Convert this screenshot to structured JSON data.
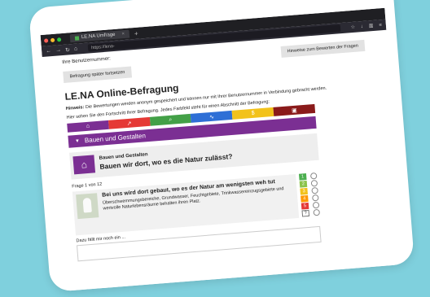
{
  "browser": {
    "tab_title": "LE.NA Umfrage",
    "url": "https://lena-",
    "colors": {
      "close": "#ff5f57",
      "min": "#febc2e",
      "max": "#28c840"
    }
  },
  "header": {
    "username_label": "Ihre Benutzernummer:",
    "resume_button": "Befragung später fortsetzen",
    "hints_button": "Hinweise zum Bewerten der Fragen"
  },
  "main": {
    "title": "LE.NA Online-Befragung",
    "note_bold": "Hinweis:",
    "note_text": " Die Bewertungen werden anonym gespeichert und können nur mit Ihrer Benutzernummer in Verbindung gebracht werden.",
    "progress_text": "Hier sehen Sie den Fortschritt Ihrer Befragung. Jedes Farbfeld steht für einen Abschnitt der Befragung:"
  },
  "progress_sections": [
    {
      "icon": "house-icon",
      "glyph": "⌂",
      "color": "#7b2f93"
    },
    {
      "icon": "road-icon",
      "glyph": "↗",
      "color": "#e53935"
    },
    {
      "icon": "search-icon",
      "glyph": "⌕",
      "color": "#43a047"
    },
    {
      "icon": "chart-icon",
      "glyph": "∿",
      "color": "#2e6fd6"
    },
    {
      "icon": "money-icon",
      "glyph": "$",
      "color": "#f2c21b"
    },
    {
      "icon": "book-icon",
      "glyph": "▣",
      "color": "#8a1a1a"
    }
  ],
  "section": {
    "title": "Bauen und Gestalten"
  },
  "question": {
    "category": "Bauen und Gestalten",
    "title": "Bauen wir dort, wo es die Natur zulässt?",
    "counter": "Frage 1 von 12",
    "item_title": "Bei uns wird dort gebaut, wo es der Natur am wenigsten weh tut",
    "item_desc": "Überschwemmungsbereiche, Grundwasser, Feuchtgebiete, Trinkwassereinzugsgebiete und wertvolle Naturlebensräume behalten ihren Platz."
  },
  "rating": [
    {
      "label": "1",
      "color": "#4caf50"
    },
    {
      "label": "2",
      "color": "#8bc34a"
    },
    {
      "label": "3",
      "color": "#f2c21b"
    },
    {
      "label": "4",
      "color": "#ff9800"
    },
    {
      "label": "5",
      "color": "#e53935"
    },
    {
      "label": "?",
      "color": "#ffffff"
    }
  ],
  "notes": {
    "label": "Dazu fällt mir noch ein ..."
  }
}
